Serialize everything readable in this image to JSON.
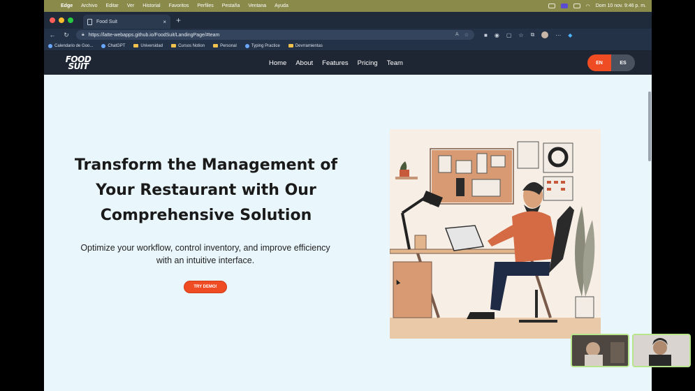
{
  "mac_menubar": {
    "app": "Edge",
    "menus": [
      "Archivo",
      "Editar",
      "Ver",
      "Historial",
      "Favoritos",
      "Perfiles",
      "Pestaña",
      "Ventana",
      "Ayuda"
    ],
    "clock": "Dom 10 nov.  9:46 p. m."
  },
  "browser": {
    "tab_title": "Food Suit",
    "address": "https://latte-webapps.github.io/FoodSuit/LandingPage/#team",
    "bookmarks": [
      "Calendario de Goo...",
      "ChatGPT",
      "Universidad",
      "Cursos Notion",
      "Personal",
      "Typing Practice",
      "Devrramientas"
    ]
  },
  "site": {
    "logo_line1": "FOOD",
    "logo_line2": "SUIT",
    "nav": [
      "Home",
      "About",
      "Features",
      "Pricing",
      "Team"
    ],
    "lang_en": "EN",
    "lang_es": "ES",
    "hero_title": "Transform the Management of Your Restaurant with Our Comprehensive Solution",
    "hero_subtitle": "Optimize your workflow, control inventory, and improve efficiency with an intuitive interface.",
    "cta": "TRY DEMO!"
  },
  "colors": {
    "accent": "#f04c23",
    "navbar": "#1e2633",
    "page_bg": "#e9f6fb"
  }
}
